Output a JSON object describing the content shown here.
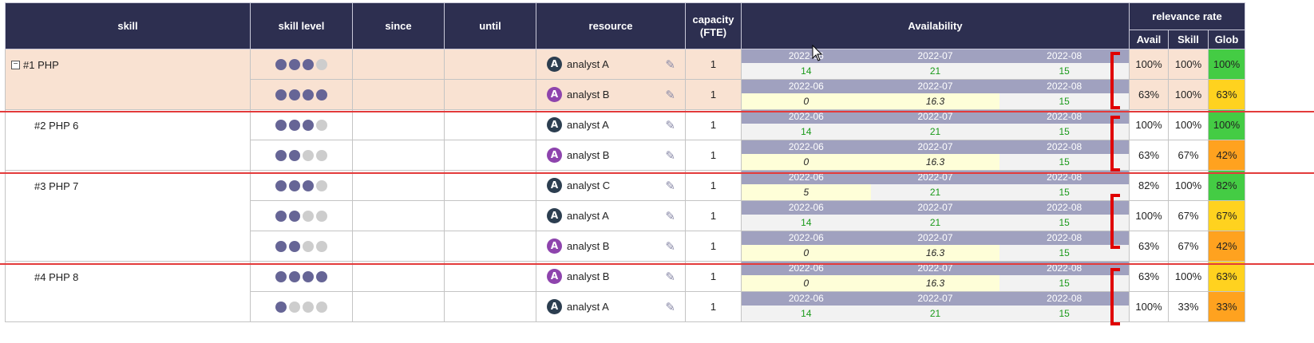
{
  "header": {
    "skill": "skill",
    "skill_level": "skill level",
    "since": "since",
    "until": "until",
    "resource": "resource",
    "capacity": "capacity (FTE)",
    "availability": "Availability",
    "relevance_rate": "relevance rate",
    "avail": "Avail",
    "skill_col": "Skill",
    "glob": "Glob"
  },
  "colors": {
    "header_bg": "#2d2f50",
    "highlight_row": "#f9e2d2",
    "avatar_dark": "#2c3e50",
    "avatar_purple": "#8e44ad",
    "glob_green": "#44cc44",
    "glob_yellow": "#ffd21f",
    "glob_orange": "#ffa21f"
  },
  "icons": {
    "edit": "pencil-icon",
    "toggle": "collapse-minus-icon"
  },
  "rows": [
    {
      "skill": "#1 PHP",
      "collapsible": true,
      "level": 3,
      "resource": "analyst A",
      "avatar": "A",
      "avatar_color": "dark",
      "capacity": "1",
      "months": [
        "2022-06",
        "2022-07",
        "2022-08"
      ],
      "values": [
        "14",
        "21",
        "15"
      ],
      "low": [
        false,
        false,
        false
      ],
      "avail": "100%",
      "skill_pct": "100%",
      "glob": "100%",
      "glob_color": "green"
    },
    {
      "skill": "",
      "level": 4,
      "resource": "analyst B",
      "avatar": "A",
      "avatar_color": "purple",
      "capacity": "1",
      "months": [
        "2022-06",
        "2022-07",
        "2022-08"
      ],
      "values": [
        "0",
        "16.3",
        "15"
      ],
      "low": [
        true,
        true,
        false
      ],
      "avail": "63%",
      "skill_pct": "100%",
      "glob": "63%",
      "glob_color": "yellow"
    },
    {
      "skill": "#2 PHP 6",
      "level": 3,
      "resource": "analyst A",
      "avatar": "A",
      "avatar_color": "dark",
      "capacity": "1",
      "months": [
        "2022-06",
        "2022-07",
        "2022-08"
      ],
      "values": [
        "14",
        "21",
        "15"
      ],
      "low": [
        false,
        false,
        false
      ],
      "avail": "100%",
      "skill_pct": "100%",
      "glob": "100%",
      "glob_color": "green"
    },
    {
      "skill": "",
      "level": 2,
      "resource": "analyst B",
      "avatar": "A",
      "avatar_color": "purple",
      "capacity": "1",
      "months": [
        "2022-06",
        "2022-07",
        "2022-08"
      ],
      "values": [
        "0",
        "16.3",
        "15"
      ],
      "low": [
        true,
        true,
        false
      ],
      "avail": "63%",
      "skill_pct": "67%",
      "glob": "42%",
      "glob_color": "orange"
    },
    {
      "skill": "#3 PHP 7",
      "level": 3,
      "resource": "analyst C",
      "avatar": "A",
      "avatar_color": "dark",
      "capacity": "1",
      "months": [
        "2022-06",
        "2022-07",
        "2022-08"
      ],
      "values": [
        "5",
        "21",
        "15"
      ],
      "low": [
        true,
        false,
        false
      ],
      "avail": "82%",
      "skill_pct": "100%",
      "glob": "82%",
      "glob_color": "green"
    },
    {
      "skill": "",
      "level": 2,
      "resource": "analyst A",
      "avatar": "A",
      "avatar_color": "dark",
      "capacity": "1",
      "months": [
        "2022-06",
        "2022-07",
        "2022-08"
      ],
      "values": [
        "14",
        "21",
        "15"
      ],
      "low": [
        false,
        false,
        false
      ],
      "avail": "100%",
      "skill_pct": "67%",
      "glob": "67%",
      "glob_color": "yellow"
    },
    {
      "skill": "",
      "level": 2,
      "resource": "analyst B",
      "avatar": "A",
      "avatar_color": "purple",
      "capacity": "1",
      "months": [
        "2022-06",
        "2022-07",
        "2022-08"
      ],
      "values": [
        "0",
        "16.3",
        "15"
      ],
      "low": [
        true,
        true,
        false
      ],
      "avail": "63%",
      "skill_pct": "67%",
      "glob": "42%",
      "glob_color": "orange"
    },
    {
      "skill": "#4 PHP 8",
      "level": 4,
      "resource": "analyst B",
      "avatar": "A",
      "avatar_color": "purple",
      "capacity": "1",
      "months": [
        "2022-06",
        "2022-07",
        "2022-08"
      ],
      "values": [
        "0",
        "16.3",
        "15"
      ],
      "low": [
        true,
        true,
        false
      ],
      "avail": "63%",
      "skill_pct": "100%",
      "glob": "63%",
      "glob_color": "yellow"
    },
    {
      "skill": "",
      "level": 1,
      "resource": "analyst A",
      "avatar": "A",
      "avatar_color": "dark",
      "capacity": "1",
      "months": [
        "2022-06",
        "2022-07",
        "2022-08"
      ],
      "values": [
        "14",
        "21",
        "15"
      ],
      "low": [
        false,
        false,
        false
      ],
      "avail": "100%",
      "skill_pct": "33%",
      "glob": "33%",
      "glob_color": "orange"
    }
  ],
  "skill_groups": [
    {
      "label": "#1 PHP",
      "rows": 2,
      "highlight": true
    },
    {
      "label": "#2 PHP 6",
      "rows": 2
    },
    {
      "label": "#3 PHP 7",
      "rows": 3
    },
    {
      "label": "#4 PHP 8",
      "rows": 2
    }
  ]
}
